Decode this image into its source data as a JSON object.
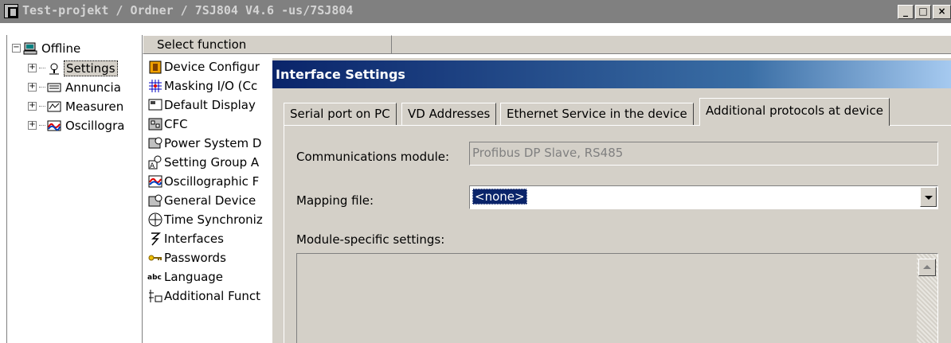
{
  "window": {
    "title": "Test-projekt / Ordner / 7SJ804 V4.6 -us/7SJ804"
  },
  "tree": {
    "root": "Offline",
    "items": [
      {
        "label": "Settings",
        "selected": true,
        "icon": "settings-icon"
      },
      {
        "label": "Annuncia",
        "icon": "annunciation-icon"
      },
      {
        "label": "Measuren",
        "icon": "measurement-icon"
      },
      {
        "label": "Oscillogra",
        "icon": "oscillography-icon"
      }
    ]
  },
  "function_list": {
    "header": "Select function",
    "items": [
      {
        "label": "Device Configur",
        "icon": "device-config-icon"
      },
      {
        "label": "Masking I/O (Cc",
        "icon": "masking-io-icon"
      },
      {
        "label": "Default Display",
        "icon": "default-display-icon"
      },
      {
        "label": "CFC",
        "icon": "cfc-icon"
      },
      {
        "label": "Power System D",
        "icon": "power-system-icon"
      },
      {
        "label": "Setting Group A",
        "icon": "setting-group-icon"
      },
      {
        "label": "Oscillographic F",
        "icon": "oscillographic-icon"
      },
      {
        "label": "General Device",
        "icon": "general-device-icon"
      },
      {
        "label": "Time Synchroniz",
        "icon": "time-sync-icon"
      },
      {
        "label": "Interfaces",
        "icon": "interfaces-icon"
      },
      {
        "label": "Passwords",
        "icon": "passwords-icon"
      },
      {
        "label": "Language",
        "icon": "language-icon"
      },
      {
        "label": "Additional Funct",
        "icon": "additional-functions-icon"
      }
    ]
  },
  "dialog": {
    "title": "Interface Settings",
    "tabs": [
      {
        "label": "Serial port on PC"
      },
      {
        "label": "VD Addresses"
      },
      {
        "label": "Ethernet Service in the device"
      },
      {
        "label": "Additional protocols at device",
        "active": true
      }
    ],
    "communications_module": {
      "label": "Communications module:",
      "value": "Profibus DP Slave, RS485"
    },
    "mapping_file": {
      "label": "Mapping file:",
      "value": "<none>"
    },
    "module_specific": {
      "label": "Module-specific settings:"
    }
  },
  "colors": {
    "face": "#d4d0c8",
    "title_active": "#0a246a",
    "title_inactive": "#808080"
  }
}
